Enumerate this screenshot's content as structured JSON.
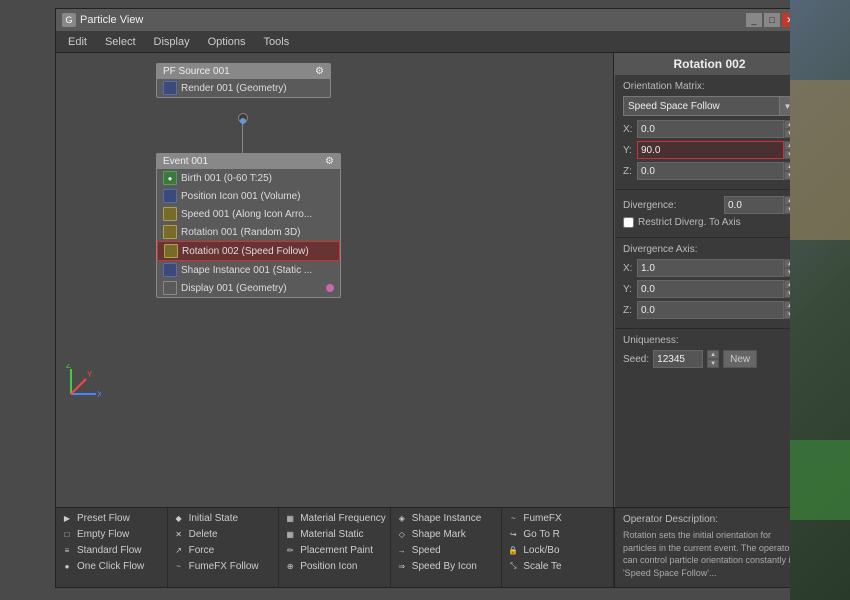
{
  "window": {
    "title": "Particle View",
    "icon": "G"
  },
  "menu": {
    "items": [
      "Edit",
      "Select",
      "Display",
      "Options",
      "Tools"
    ]
  },
  "node_graph": {
    "pf_source": {
      "label": "PF Source 001",
      "items": [
        {
          "id": "render001",
          "label": "Render 001 (Geometry)",
          "icon_type": "blue"
        }
      ]
    },
    "event": {
      "label": "Event 001",
      "items": [
        {
          "id": "birth001",
          "label": "Birth 001 (0-60 T:25)",
          "icon_type": "green"
        },
        {
          "id": "position001",
          "label": "Position Icon 001 (Volume)",
          "icon_type": "blue"
        },
        {
          "id": "speed001",
          "label": "Speed 001 (Along Icon Arro...",
          "icon_type": "yellow"
        },
        {
          "id": "rotation001",
          "label": "Rotation 001 (Random 3D)",
          "icon_type": "yellow"
        },
        {
          "id": "rotation002",
          "label": "Rotation 002 (Speed Follow)",
          "icon_type": "yellow",
          "selected": true
        },
        {
          "id": "shape001",
          "label": "Shape Instance 001 (Static ...",
          "icon_type": "blue"
        },
        {
          "id": "display001",
          "label": "Display 001 (Geometry)",
          "icon_type": "gray",
          "has_pink_dot": true
        }
      ]
    }
  },
  "right_panel": {
    "title": "Rotation 002",
    "orientation_matrix": {
      "label": "Orientation Matrix:",
      "dropdown_value": "Speed Space Follow",
      "x": {
        "label": "X:",
        "value": "0.0"
      },
      "y": {
        "label": "Y:",
        "value": "90.0",
        "highlighted": true
      },
      "z": {
        "label": "Z:",
        "value": "0.0"
      }
    },
    "divergence": {
      "label": "Divergence:",
      "value": "0.0"
    },
    "restrict_checkbox": {
      "label": "Restrict Diverg. To Axis",
      "checked": false
    },
    "divergence_axis": {
      "label": "Divergence Axis:",
      "x": {
        "label": "X:",
        "value": "1.0"
      },
      "y": {
        "label": "Y:",
        "value": "0.0"
      },
      "z": {
        "label": "Z:",
        "value": "0.0"
      }
    },
    "uniqueness": {
      "label": "Uniqueness:",
      "seed_label": "Seed:",
      "seed_value": "12345",
      "new_btn": "New"
    }
  },
  "bottom_toolbar": {
    "columns": [
      {
        "items": [
          {
            "label": "Preset Flow",
            "icon": "▶"
          },
          {
            "label": "Empty Flow",
            "icon": "□"
          },
          {
            "label": "Standard Flow",
            "icon": "≡"
          },
          {
            "label": "One Click Flow",
            "icon": "●"
          }
        ]
      },
      {
        "items": [
          {
            "label": "Initial State",
            "icon": "◆"
          },
          {
            "label": "Delete",
            "icon": "✕"
          },
          {
            "label": "Force",
            "icon": "↗"
          },
          {
            "label": "FumeFX Follow",
            "icon": "~"
          }
        ]
      },
      {
        "items": [
          {
            "label": "Material Frequency",
            "icon": "▦"
          },
          {
            "label": "Material Static",
            "icon": "▦"
          },
          {
            "label": "Placement Paint",
            "icon": "✏"
          },
          {
            "label": "Position Icon",
            "icon": "⊕"
          }
        ]
      },
      {
        "items": [
          {
            "label": "Shape Instance",
            "icon": "◈"
          },
          {
            "label": "Shape Mark",
            "icon": "◇"
          },
          {
            "label": "Speed",
            "icon": "→"
          },
          {
            "label": "Speed By Icon",
            "icon": "⇒"
          }
        ]
      },
      {
        "items": [
          {
            "label": "FumeFX",
            "icon": "~"
          },
          {
            "label": "Go To R",
            "icon": "↪"
          },
          {
            "label": "Lock/Bo",
            "icon": "🔒"
          },
          {
            "label": "Scale Te",
            "icon": "⤡"
          }
        ]
      }
    ]
  },
  "description": {
    "title": "Operator Description:",
    "text": "Rotation sets the initial orientation for particles in the current event. The operator can control particle orientation constantly if 'Speed Space Follow'..."
  }
}
